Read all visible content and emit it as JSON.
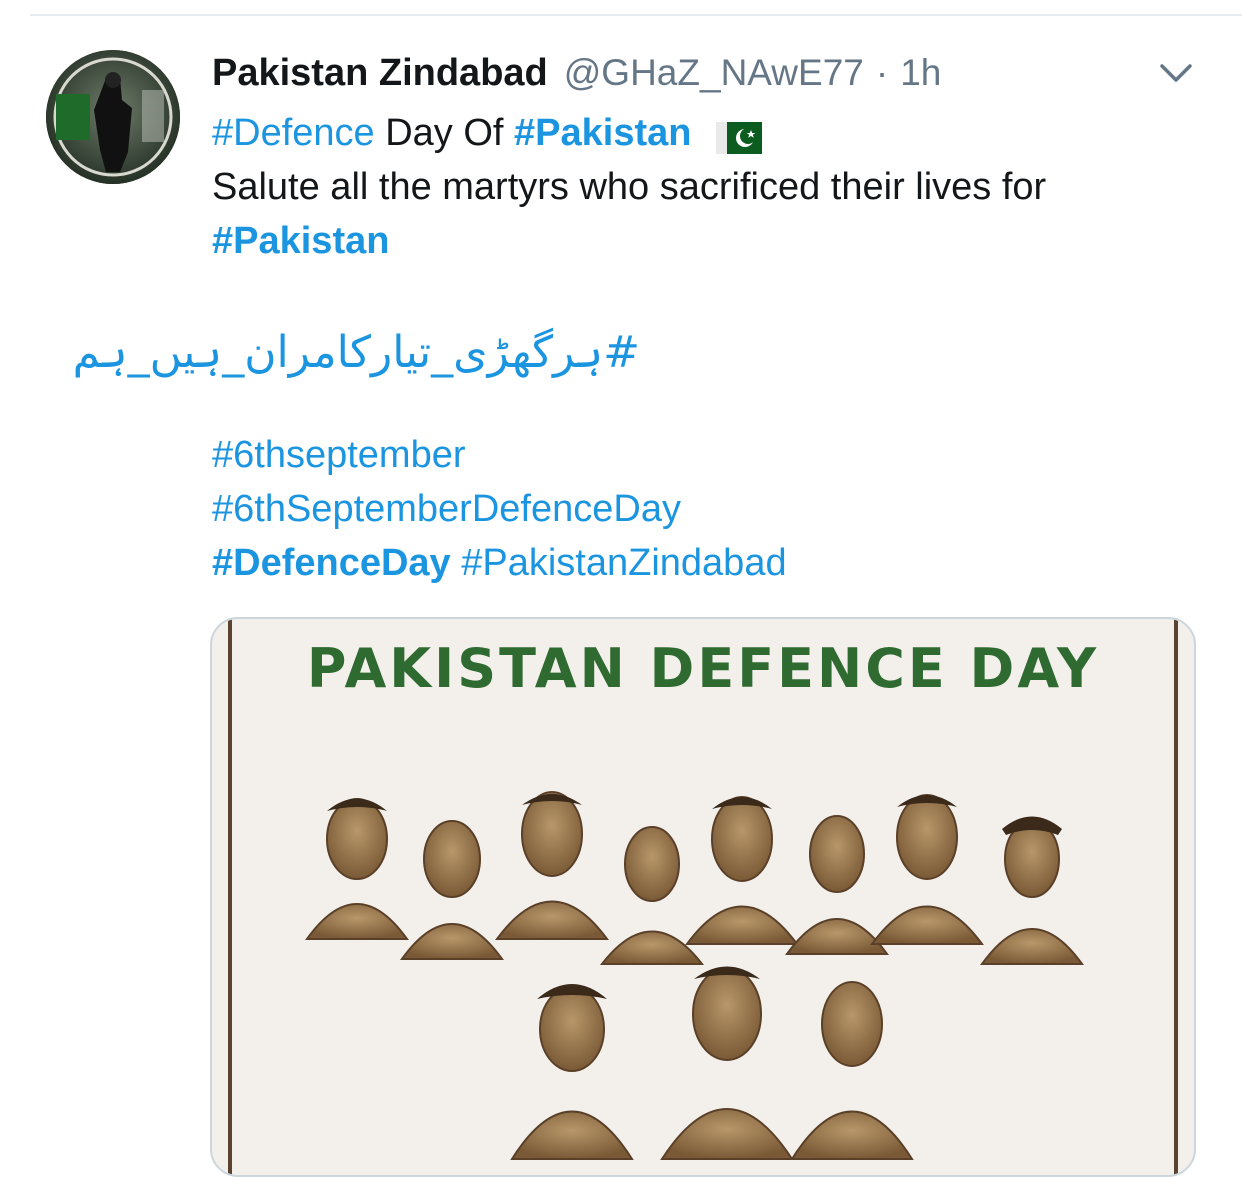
{
  "tweet": {
    "display_name": "Pakistan Zindabad",
    "handle": "@GHaZ_NAwE77",
    "separator": "·",
    "time": "1h",
    "line1": {
      "tag1": "#Defence",
      "text1": " Day Of ",
      "tag2": "#Pakistan"
    },
    "line2": {
      "text": "Salute all the martyrs who sacrificed their lives for"
    },
    "line3": {
      "tag": "#Pakistan"
    },
    "urdu_hashtag": "#ہرگھڑی_تیارکامران_ہیں_ہم",
    "tags": {
      "t1": "#6thseptember",
      "t2": "#6thSeptemberDefenceDay",
      "t3": "#DefenceDay",
      "t4": "#PakistanZindabad"
    }
  },
  "media": {
    "title": "PAKISTAN DEFENCE DAY"
  },
  "icons": {
    "caret": "chevron-down-icon",
    "flag": "pakistan-flag-icon"
  },
  "colors": {
    "link": "#1b95e0",
    "text": "#14171a",
    "secondary": "#657786",
    "media_title": "#2f6a30"
  }
}
